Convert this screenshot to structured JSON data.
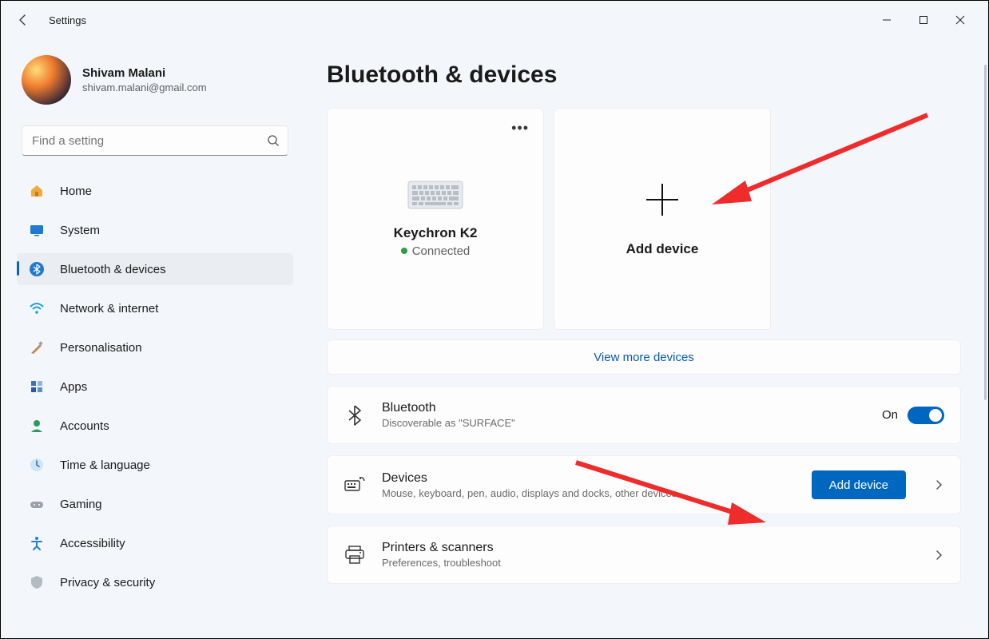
{
  "app": {
    "title": "Settings"
  },
  "profile": {
    "name": "Shivam Malani",
    "email": "shivam.malani@gmail.com"
  },
  "search": {
    "placeholder": "Find a setting"
  },
  "nav": {
    "home": "Home",
    "system": "System",
    "bluetooth": "Bluetooth & devices",
    "network": "Network & internet",
    "personalisation": "Personalisation",
    "apps": "Apps",
    "accounts": "Accounts",
    "time": "Time & language",
    "gaming": "Gaming",
    "accessibility": "Accessibility",
    "privacy": "Privacy & security"
  },
  "page": {
    "title": "Bluetooth & devices",
    "device_tile": {
      "name": "Keychron K2",
      "status": "Connected"
    },
    "add_tile": {
      "label": "Add device"
    },
    "view_more": "View more devices",
    "bluetooth_card": {
      "title": "Bluetooth",
      "sub": "Discoverable as \"SURFACE\"",
      "state": "On"
    },
    "devices_card": {
      "title": "Devices",
      "sub": "Mouse, keyboard, pen, audio, displays and docks, other devices",
      "button": "Add device"
    },
    "printers_card": {
      "title": "Printers & scanners",
      "sub": "Preferences, troubleshoot"
    }
  }
}
